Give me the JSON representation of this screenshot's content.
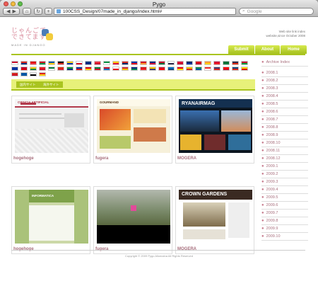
{
  "window": {
    "title": "Pygo"
  },
  "toolbar": {
    "url": "100CSS_Design/07made_in_django/index.html#",
    "search_placeholder": "Google"
  },
  "site": {
    "logo_text": "じゃんごで\nできてます",
    "logo_sub": "MADE IN DJANGO",
    "tagline_line1": "Web site link index",
    "tagline_line2": "website,since October 2008",
    "nav": [
      "Submit",
      "About",
      "Home"
    ],
    "subtabs": [
      "国内サイト",
      "海外サイト"
    ],
    "footer": "Copyright © 2009 Pygo Allomaina All Rights Reserved"
  },
  "archive": {
    "title": "Archive Index",
    "items": [
      "2008.1",
      "2008.2",
      "2008.3",
      "2008.4",
      "2008.5",
      "2008.6",
      "2008.7",
      "2008.8",
      "2008.9",
      "2008.10",
      "2008.11",
      "2008.12",
      "2009.1",
      "2009.2",
      "2009.3",
      "2009.4",
      "2009.5",
      "2009.6",
      "2009.7",
      "2009.8",
      "2009.9",
      "2009.10"
    ]
  },
  "cards": [
    {
      "caption": "hogehoge",
      "theme": "s1",
      "label": "CIENCIA ARTIFICIAL"
    },
    {
      "caption": "fugera",
      "theme": "s2",
      "label": "GOURMAND"
    },
    {
      "caption": "MOGERA",
      "theme": "s3",
      "label": "RYANAIRMAG"
    },
    {
      "caption": "hogehoge",
      "theme": "s4",
      "label": "INFORMATICA"
    },
    {
      "caption": "fugera",
      "theme": "s5",
      "label": ""
    },
    {
      "caption": "MOGERA",
      "theme": "s6",
      "label": "CROWN GARDENS"
    }
  ],
  "flag_colors": [
    "#c8102e",
    "#da291c",
    "#dd0000",
    "#ce1126",
    "#0055a4",
    "#000000",
    "#fcd116",
    "#ffffff",
    "#003580",
    "#ef3340",
    "#009246",
    "#ffcd00",
    "#d52b1e",
    "#0038a8",
    "#ce1126",
    "#00247d",
    "#c8102e",
    "#ffffff",
    "#dc143c",
    "#002868",
    "#e30a17",
    "#ff9933",
    "#d21034",
    "#006c35",
    "#2d2a4a",
    "#c60c30",
    "#0032a0",
    "#bc002d",
    "#fcd116",
    "#ee1c25",
    "#007a3d",
    "#de2910",
    "#009b3a",
    "#0033a0",
    "#da020e",
    "#00843d",
    "#c8102e",
    "#ffffff",
    "#ce2b37",
    "#002b7f",
    "#d7141a",
    "#ffcc00",
    "#cf142b",
    "#0072c6",
    "#e70013",
    "#f4c300",
    "#008751",
    "#ef2b2d",
    "#3c3b6e",
    "#ff0000",
    "#11457e",
    "#fedf00",
    "#d52b1e",
    "#0055a4",
    "#ffffff",
    "#dc241f"
  ],
  "colors": {
    "accent_green": "#a9c41f",
    "link_pink": "#a86f7d"
  }
}
